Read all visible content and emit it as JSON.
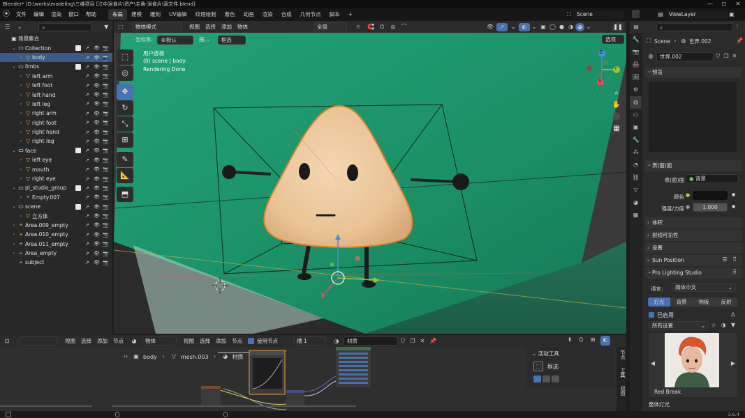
{
  "titlebar": {
    "title": "Blender* [D:\\works\\modeling\\三维项目 [江中涡食片\\资产\\主角-涡食片\\源文件.blend]",
    "min": "—",
    "max": "◻",
    "close": "✕"
  },
  "menubar": {
    "menus": [
      "文件",
      "编辑",
      "渲染",
      "窗口",
      "帮助"
    ],
    "workspaces": [
      "布局",
      "建模",
      "雕刻",
      "UV编辑",
      "纹理绘制",
      "着色",
      "动画",
      "渲染",
      "合成",
      "几何节点",
      "脚本"
    ],
    "add_tab": "+",
    "scene": "Scene",
    "viewlayer": "ViewLayer"
  },
  "outliner": {
    "root": "场景集合",
    "rows": [
      {
        "label": "Collection",
        "indent": 1,
        "type": "collection",
        "arrow": "⌄"
      },
      {
        "label": "body",
        "indent": 2,
        "type": "mesh",
        "arrow": "›",
        "selected": true
      },
      {
        "label": "limbs",
        "indent": 1,
        "type": "collection",
        "arrow": "⌄"
      },
      {
        "label": "left arm",
        "indent": 2,
        "type": "mesh",
        "arrow": "›"
      },
      {
        "label": "left foot",
        "indent": 2,
        "type": "mesh",
        "arrow": "›"
      },
      {
        "label": "left hand",
        "indent": 2,
        "type": "mesh",
        "arrow": "›"
      },
      {
        "label": "left leg",
        "indent": 2,
        "type": "mesh",
        "arrow": "›"
      },
      {
        "label": "right arm",
        "indent": 2,
        "type": "mesh",
        "arrow": "›"
      },
      {
        "label": "right foot",
        "indent": 2,
        "type": "mesh",
        "arrow": "›"
      },
      {
        "label": "right hand",
        "indent": 2,
        "type": "mesh",
        "arrow": "›"
      },
      {
        "label": "right leg",
        "indent": 2,
        "type": "mesh",
        "arrow": "›"
      },
      {
        "label": "face",
        "indent": 1,
        "type": "collection",
        "arrow": "⌄"
      },
      {
        "label": "left eye",
        "indent": 2,
        "type": "mesh",
        "arrow": "›"
      },
      {
        "label": "mouth",
        "indent": 2,
        "type": "mesh",
        "arrow": "›"
      },
      {
        "label": "right eye",
        "indent": 2,
        "type": "mesh",
        "arrow": "›"
      },
      {
        "label": "pl_studio_group",
        "indent": 1,
        "type": "collection",
        "arrow": "⌄"
      },
      {
        "label": "Empty.007",
        "indent": 2,
        "type": "empty",
        "arrow": "›"
      },
      {
        "label": "scene",
        "indent": 1,
        "type": "collection",
        "arrow": "⌄"
      },
      {
        "label": "立方体",
        "indent": 2,
        "type": "mesh",
        "arrow": "›"
      },
      {
        "label": "Area.009_empty",
        "indent": 1,
        "type": "empty",
        "arrow": "›"
      },
      {
        "label": "Area.010_empty",
        "indent": 1,
        "type": "empty",
        "arrow": "›"
      },
      {
        "label": "Area.011_empty",
        "indent": 1,
        "type": "empty",
        "arrow": "›"
      },
      {
        "label": "Area_empty",
        "indent": 1,
        "type": "empty",
        "arrow": "›"
      },
      {
        "label": "subject",
        "indent": 1,
        "type": "empty",
        "arrow": ""
      }
    ]
  },
  "viewport": {
    "mode": "物体模式",
    "menus": [
      "视图",
      "选择",
      "添加",
      "物体"
    ],
    "transform_orient": "全局",
    "coord_label": "坐标系:",
    "coord_value": "默认",
    "drag_label": "拖...",
    "select_mode": "框选",
    "options": "选项",
    "overlay_lines": [
      "用户透视",
      "(0) scene | body",
      "Rendering Done"
    ],
    "gizmo_axes": [
      "X",
      "Y",
      "Z"
    ]
  },
  "node_editor": {
    "menus": [
      "视图",
      "选择",
      "添加",
      "节点"
    ],
    "object_mode": "物体",
    "menus2": [
      "视图",
      "选择",
      "添加",
      "节点"
    ],
    "use_nodes": "使用节点",
    "slot": "槽 1",
    "material": "材质",
    "breadcrumb": [
      "body",
      "mesh.003",
      "材质"
    ],
    "active_tool_title": "活动工具",
    "active_tool_name": "框选",
    "side_tabs": [
      "节点",
      "工具",
      "视图"
    ]
  },
  "properties": {
    "scene": "Scene",
    "world": "世界.002",
    "world_field": "世界.002",
    "preview": "预览",
    "surface": "表(面)面",
    "surface_label": "表(面)面",
    "surface_value": "背景",
    "color_label": "颜色",
    "strength_label": "强度/力度",
    "strength_value": "1.000",
    "volume": "体积",
    "ray_visibility": "射线可见性",
    "settings": "设置",
    "sun_position": "Sun Position",
    "pro_lighting": "Pro Lighting Studio",
    "lang_label": "语言:",
    "lang_value": "简体中文",
    "pls_tabs": [
      "灯光",
      "背景",
      "地板",
      "反射"
    ],
    "enabled": "已启用",
    "all_settings": "所有设置",
    "preset_name": "Red Break",
    "bottom_label": "整体灯光"
  },
  "status": {
    "version": "3.6.4"
  },
  "colors": {
    "accent": "#4772b3",
    "green": "#1f9a6a",
    "selection": "#3c5a86"
  }
}
